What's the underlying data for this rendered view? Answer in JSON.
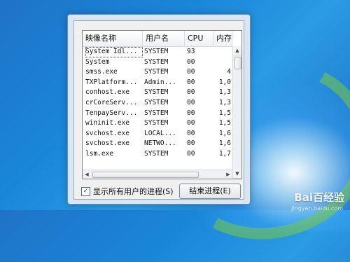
{
  "task_manager": {
    "columns": {
      "image_name": "映像名称",
      "user_name": "用户名",
      "cpu": "CPU",
      "memory": "内存"
    },
    "processes": [
      {
        "name": "System Idl...",
        "user": "SYSTEM",
        "cpu": "93",
        "mem": "",
        "selected": true
      },
      {
        "name": "System",
        "user": "SYSTEM",
        "cpu": "00",
        "mem": ""
      },
      {
        "name": "smss.exe",
        "user": "SYSTEM",
        "cpu": "00",
        "mem": "4"
      },
      {
        "name": "TXPlatform...",
        "user": "Admin...",
        "cpu": "00",
        "mem": "1,0"
      },
      {
        "name": "conhost.exe",
        "user": "SYSTEM",
        "cpu": "00",
        "mem": "1,3"
      },
      {
        "name": "crCoreServ...",
        "user": "SYSTEM",
        "cpu": "00",
        "mem": "1,3"
      },
      {
        "name": "TenpayServ...",
        "user": "SYSTEM",
        "cpu": "00",
        "mem": "1,5"
      },
      {
        "name": "wininit.exe",
        "user": "SYSTEM",
        "cpu": "00",
        "mem": "1,5"
      },
      {
        "name": "svchost.exe",
        "user": "LOCAL...",
        "cpu": "00",
        "mem": "1,6"
      },
      {
        "name": "svchost.exe",
        "user": "NETWO...",
        "cpu": "00",
        "mem": "1,6"
      },
      {
        "name": "lsm.exe",
        "user": "SYSTEM",
        "cpu": "00",
        "mem": "1,7"
      }
    ],
    "show_all_users_label": "显示所有用户的进程(S)",
    "show_all_users_checked": true,
    "end_process_label": "结束进程(E)"
  },
  "watermark": {
    "main": "Bai百经验",
    "sub": "jingyan.baidu.com"
  }
}
